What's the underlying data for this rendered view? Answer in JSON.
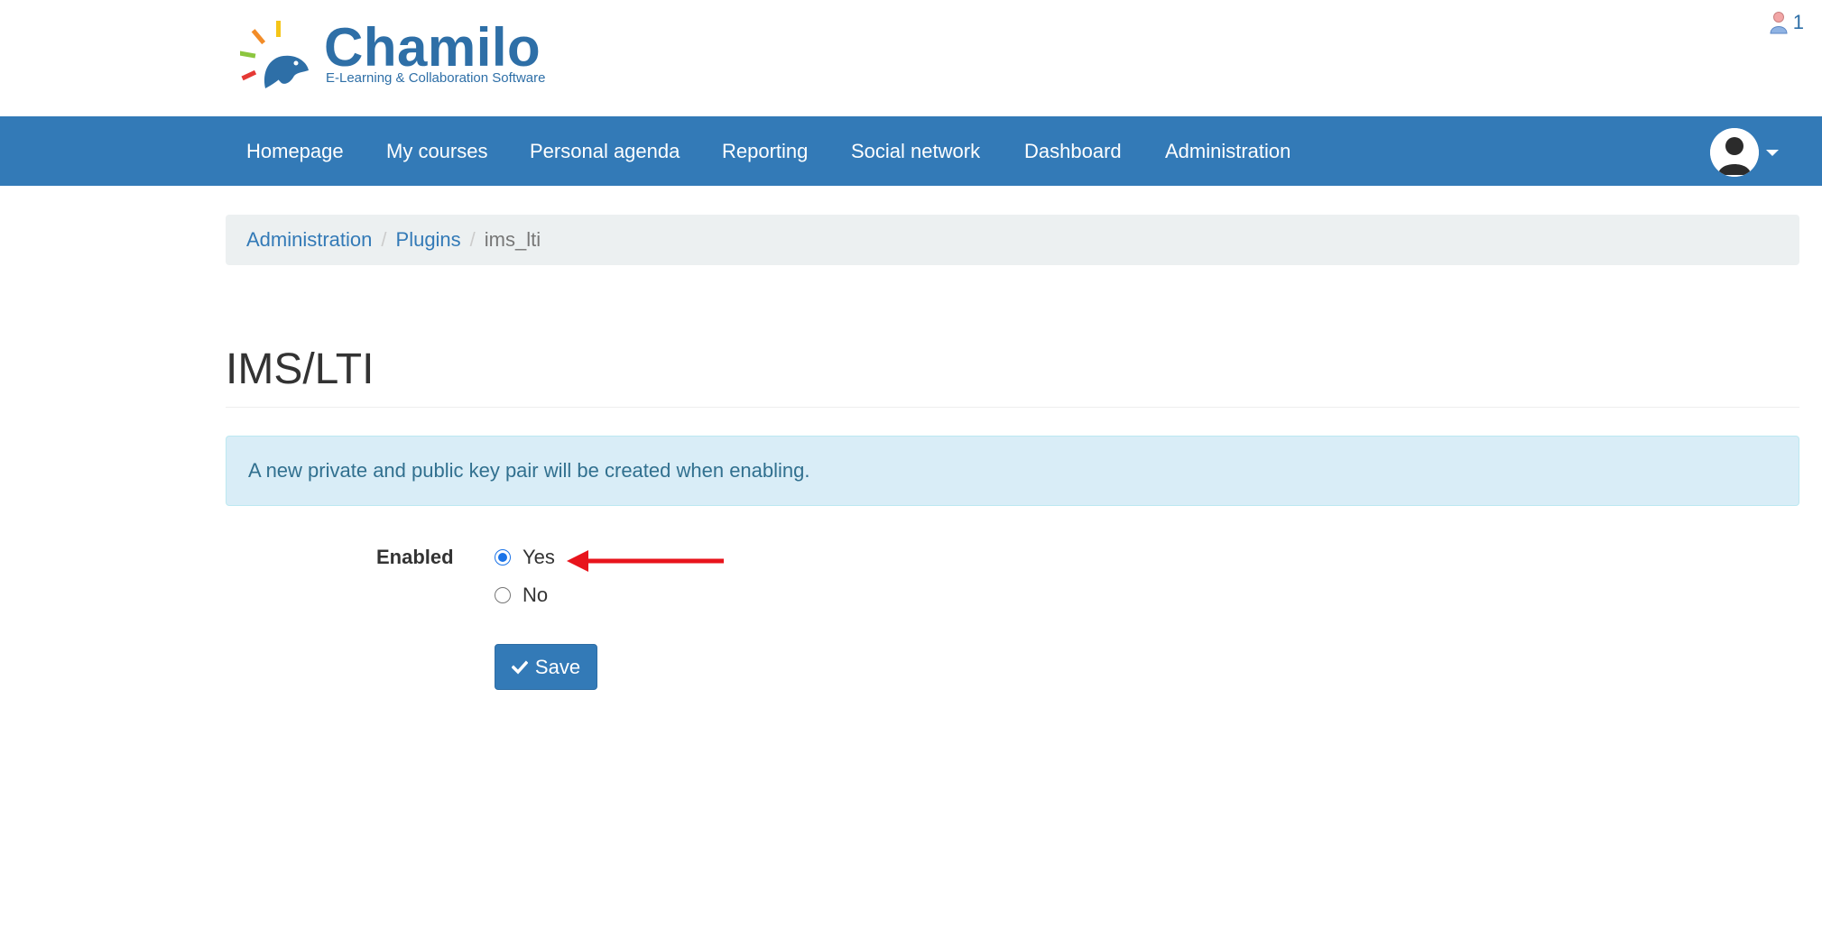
{
  "header": {
    "logo_title": "Chamilo",
    "logo_subtitle": "E-Learning & Collaboration Software",
    "notifications_count": "1"
  },
  "nav": {
    "items": [
      {
        "label": "Homepage"
      },
      {
        "label": "My courses"
      },
      {
        "label": "Personal agenda"
      },
      {
        "label": "Reporting"
      },
      {
        "label": "Social network"
      },
      {
        "label": "Dashboard"
      },
      {
        "label": "Administration"
      }
    ]
  },
  "breadcrumb": {
    "items": [
      "Administration",
      "Plugins"
    ],
    "separator": "/",
    "current": "ims_lti"
  },
  "page": {
    "title": "IMS/LTI",
    "alert": "A new private and public key pair will be created when enabling."
  },
  "form": {
    "enabled_label": "Enabled",
    "options": [
      {
        "label": "Yes",
        "checked": true
      },
      {
        "label": "No",
        "checked": false
      }
    ],
    "save_label": "Save"
  },
  "colors": {
    "navbar": "#337ab7",
    "alert_bg": "#d9edf7",
    "annotation_arrow": "#e8141c"
  }
}
